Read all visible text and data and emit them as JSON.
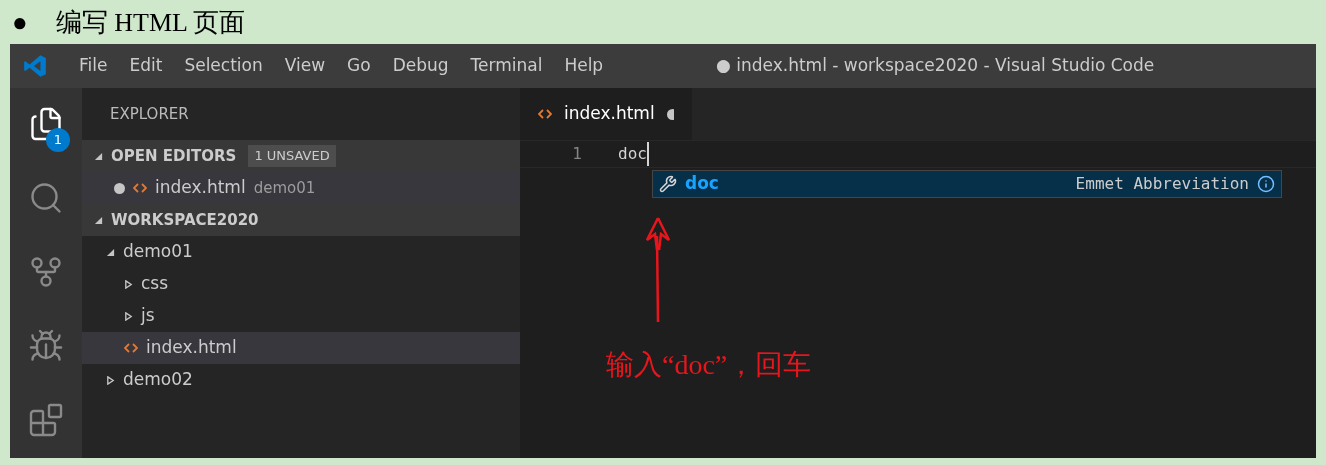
{
  "heading": {
    "bullet": "●",
    "text": "编写 HTML 页面"
  },
  "menu": [
    "File",
    "Edit",
    "Selection",
    "View",
    "Go",
    "Debug",
    "Terminal",
    "Help"
  ],
  "window_title": "● index.html - workspace2020 - Visual Studio Code",
  "activity_bar": [
    {
      "kind": "files",
      "badge": "1",
      "selected": true
    },
    {
      "kind": "search",
      "selected": false
    },
    {
      "kind": "source-control",
      "selected": false
    },
    {
      "kind": "debug",
      "selected": false
    },
    {
      "kind": "extensions",
      "selected": false
    }
  ],
  "explorer": {
    "title": "EXPLORER",
    "open_editors": {
      "title": "OPEN EDITORS",
      "badge": "1 UNSAVED",
      "expanded": true,
      "items": [
        {
          "name": "index.html",
          "folder": "demo01",
          "modified": true
        }
      ]
    },
    "workspace": {
      "title": "WORKSPACE2020",
      "expanded": true,
      "children": [
        {
          "name": "demo01",
          "kind": "folder",
          "expanded": true,
          "selected": false,
          "children": [
            {
              "name": "css",
              "kind": "folder",
              "expanded": false,
              "selected": false
            },
            {
              "name": "js",
              "kind": "folder",
              "expanded": false,
              "selected": false
            },
            {
              "name": "index.html",
              "kind": "file",
              "selected": true
            }
          ]
        },
        {
          "name": "demo02",
          "kind": "folder",
          "expanded": false,
          "selected": false
        }
      ]
    }
  },
  "editor": {
    "tab": {
      "label": "index.html",
      "modified": true
    },
    "lines": [
      {
        "number": "1",
        "text": "doc"
      }
    ],
    "suggestion": {
      "label": "doc",
      "detail": "Emmet Abbreviation"
    },
    "annotation": {
      "text": "输入“doc”，回车"
    }
  }
}
